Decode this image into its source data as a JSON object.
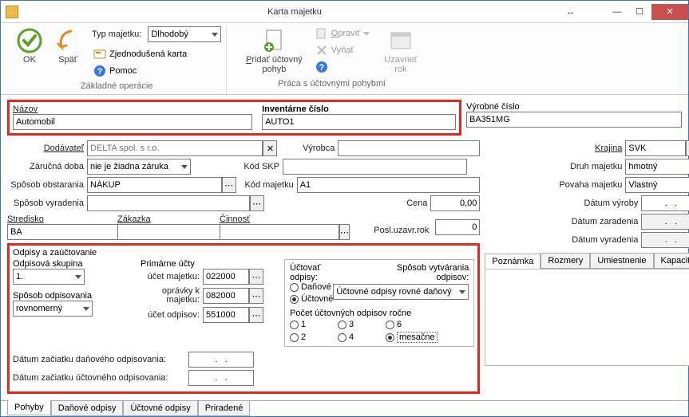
{
  "window": {
    "title": "Karta majetku"
  },
  "ribbon": {
    "ok": "OK",
    "back": "Späť",
    "type_label": "Typ majetku:",
    "type_value": "Dlhodobý",
    "simplified": "Zjednodušená karta",
    "help": "Pomoc",
    "group1": "Základné operácie",
    "add_move": "Pridať účtovný\npohyb",
    "edit": "Opraviť",
    "remove": "Vyňať",
    "help2": "",
    "close_year": "Uzavrieť\nrok",
    "group2": "Práca s účtovnými pohybmi"
  },
  "fields": {
    "name_label": "Názov",
    "name_value": "Automobil",
    "inv_label": "Inventárne číslo",
    "inv_value": "AUTO1",
    "serial_label": "Výrobné číslo",
    "serial_value": "BA351MG",
    "supplier_label": "Dodávateľ",
    "supplier_value": "DELTA spol. s r.o.",
    "maker_label": "Výrobca",
    "maker_value": "",
    "country_label": "Krajina",
    "country_value": "SVK",
    "warranty_label": "Záručná doba",
    "warranty_value": "nie je žiadna záruka",
    "skp_label": "Kód SKP",
    "skp_value": "",
    "kind_label": "Druh majetku",
    "kind_value": "hmotný",
    "obtain_label": "Spôsob obstarania",
    "obtain_value": "NÁKUP",
    "asset_code_label": "Kód majetku",
    "asset_code_value": "A1",
    "nature_label": "Povaha majetku",
    "nature_value": "Vlastný",
    "discard_label": "Spôsob vyradenia",
    "discard_value": "",
    "price_label": "Cena",
    "price_value": "0,00",
    "made_label": "Dátum výroby",
    "empty_date": ".   .",
    "center_label": "Stredisko",
    "center_value": "BA",
    "order_label": "Zákazka",
    "order_value": "",
    "activity_label": "Činnosť",
    "activity_value": "",
    "last_close_label": "Posl.uzavr.rok",
    "last_close_value": "0",
    "date_in_label": "Dátum zaradenia",
    "date_out_label": "Dátum vyradenia"
  },
  "dep": {
    "title": "Odpisy a zaúčtovanie",
    "group_label": "Odpisová skupina",
    "group_value": "1.",
    "method_label": "Spôsob odpisovania",
    "method_value": "rovnomerný",
    "primary_label": "Primárne účty",
    "acct_asset_label": "účet majetku:",
    "acct_asset_value": "022000",
    "acct_corr_label": "oprávky k\nmajetku:",
    "acct_corr_value": "082000",
    "acct_dep_label": "účet odpisov:",
    "acct_dep_value": "551000",
    "tax_start_label": "Dátum začiatku daňového odpisovania:",
    "acc_start_label": "Dátum začiatku účtovného odpisovania:",
    "book_label": "Účtovať odpisy:",
    "book_tax": "Daňové",
    "book_acc": "Účtovné",
    "create_label": "Spôsob vytvárania\nodpisov:",
    "create_value": "Účtovné odpisy rovné daňový",
    "count_label": "Počet účtovných odpisov ročne",
    "opt1": "1",
    "opt2": "2",
    "opt3": "3",
    "opt4": "4",
    "opt6": "6",
    "opt_month": "mesačne"
  },
  "right_tabs": {
    "t1": "Poznámka",
    "t2": "Rozmery",
    "t3": "Umiestnenie",
    "t4": "Kapacita"
  },
  "bottom_tabs": {
    "t1": "Pohyby",
    "t2": "Daňové odpisy",
    "t3": "Účtovné odpisy",
    "t4": "Priradené"
  }
}
